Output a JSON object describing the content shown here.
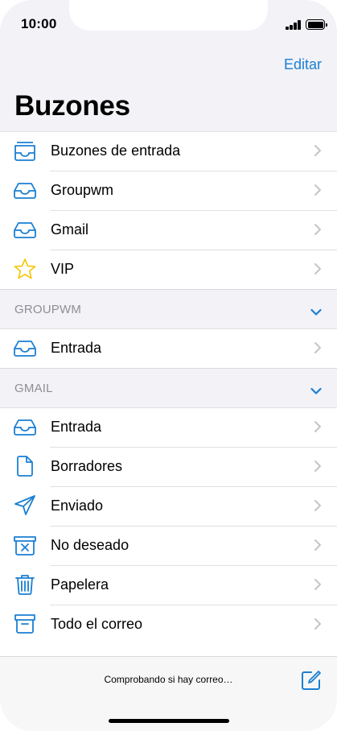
{
  "status_bar": {
    "time": "10:00"
  },
  "nav": {
    "edit_label": "Editar",
    "title": "Buzones"
  },
  "main_list": [
    {
      "label": "Buzones de entrada",
      "icon": "inboxes-icon"
    },
    {
      "label": "Groupwm",
      "icon": "inbox-icon"
    },
    {
      "label": "Gmail",
      "icon": "inbox-icon"
    },
    {
      "label": "VIP",
      "icon": "star-icon"
    }
  ],
  "accounts": [
    {
      "title": "GROUPWM",
      "items": [
        {
          "label": "Entrada",
          "icon": "inbox-icon"
        }
      ]
    },
    {
      "title": "GMAIL",
      "items": [
        {
          "label": "Entrada",
          "icon": "inbox-icon"
        },
        {
          "label": "Borradores",
          "icon": "document-icon"
        },
        {
          "label": "Enviado",
          "icon": "paper-plane-icon"
        },
        {
          "label": "No deseado",
          "icon": "junk-icon"
        },
        {
          "label": "Papelera",
          "icon": "trash-icon"
        },
        {
          "label": "Todo el correo",
          "icon": "archive-icon"
        }
      ]
    }
  ],
  "toolbar": {
    "status": "Comprobando si hay correo…",
    "compose_icon": "compose-icon"
  },
  "colors": {
    "accent": "#1a7fd3",
    "star": "#f5c400",
    "grouped_bg": "#f2f2f7",
    "secondary_text": "#8e8e93"
  }
}
